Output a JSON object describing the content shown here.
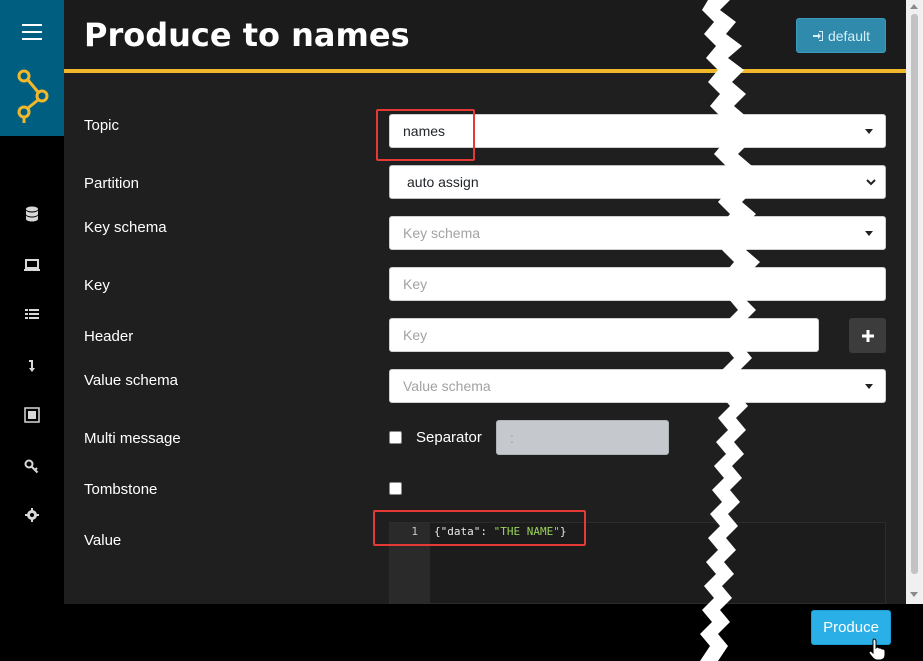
{
  "header": {
    "title": "Produce to names",
    "default_label": "default"
  },
  "sidebar": {
    "icons": [
      "database-icon",
      "laptop-icon",
      "list-icon",
      "arrow-down-icon",
      "schema-icon",
      "key-icon",
      "gear-icon"
    ]
  },
  "form": {
    "topic": {
      "label": "Topic",
      "value": "names"
    },
    "partition": {
      "label": "Partition",
      "value": "auto assign"
    },
    "key_schema": {
      "label": "Key schema",
      "placeholder": "Key schema"
    },
    "key": {
      "label": "Key",
      "placeholder": "Key"
    },
    "header": {
      "label": "Header",
      "placeholder": "Key"
    },
    "value_schema": {
      "label": "Value schema",
      "placeholder": "Value schema"
    },
    "multi_message": {
      "label": "Multi message",
      "separator_label": "Separator",
      "separator_value": ":"
    },
    "tombstone": {
      "label": "Tombstone"
    },
    "value": {
      "label": "Value",
      "line_number": "1",
      "code_prefix": "{\"data\": ",
      "code_string": "\"THE NAME\"",
      "code_suffix": "}"
    }
  },
  "footer": {
    "produce_label": "Produce"
  },
  "colors": {
    "accent": "#f2b82b",
    "sidebar_top": "#005f81",
    "produce": "#2ab0e6",
    "highlight": "#e53935"
  }
}
